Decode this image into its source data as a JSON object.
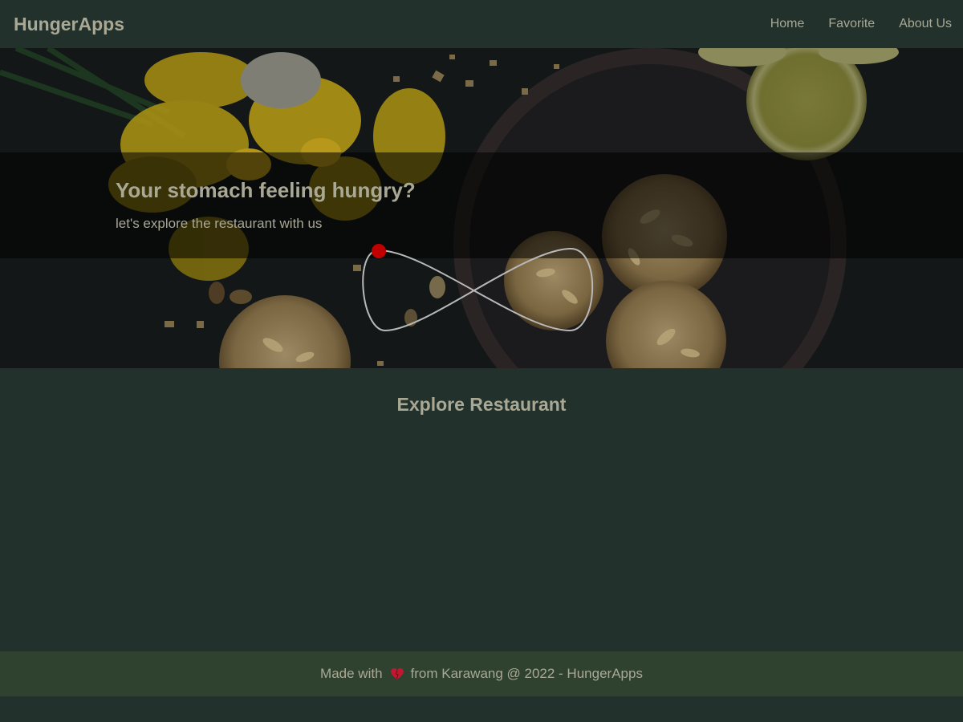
{
  "navbar": {
    "brand": "HungerApps",
    "links": [
      {
        "label": "Home"
      },
      {
        "label": "Favorite"
      },
      {
        "label": "About Us"
      }
    ]
  },
  "hero": {
    "title": "Your stomach feeling hungry?",
    "subtitle": "let's explore the restaurant with us",
    "loader_icon": "infinity-loader-icon"
  },
  "main": {
    "section_title": "Explore Restaurant"
  },
  "footer": {
    "text_before": "Made with",
    "heart_icon": "heart-icon",
    "text_after": "from Karawang @ 2022 - HungerApps"
  },
  "colors": {
    "background": "#22312b",
    "footer_bg": "#2f4230",
    "text": "#a9a895",
    "loader_dot": "#c00000"
  }
}
